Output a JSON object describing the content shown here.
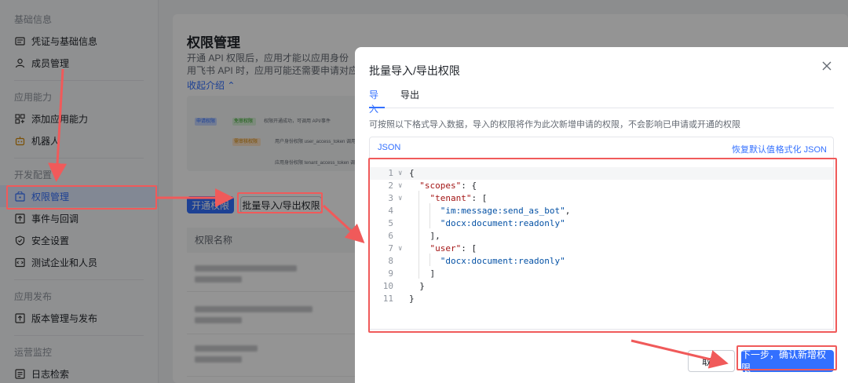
{
  "sidebar": {
    "groups": [
      {
        "title": "基础信息",
        "items": [
          {
            "label": "凭证与基础信息",
            "icon": "id-card-icon"
          },
          {
            "label": "成员管理",
            "icon": "person-icon"
          }
        ]
      },
      {
        "title": "应用能力",
        "items": [
          {
            "label": "添加应用能力",
            "icon": "grid-plus-icon"
          },
          {
            "label": "机器人",
            "icon": "robot-icon"
          }
        ]
      },
      {
        "title": "开发配置",
        "items": [
          {
            "label": "权限管理",
            "icon": "lock-box-icon",
            "active": true
          },
          {
            "label": "事件与回调",
            "icon": "event-icon"
          },
          {
            "label": "安全设置",
            "icon": "shield-icon"
          },
          {
            "label": "测试企业和人员",
            "icon": "test-icon"
          }
        ]
      },
      {
        "title": "应用发布",
        "items": [
          {
            "label": "版本管理与发布",
            "icon": "upload-icon"
          }
        ]
      },
      {
        "title": "运营监控",
        "items": [
          {
            "label": "日志检索",
            "icon": "log-icon"
          }
        ]
      }
    ]
  },
  "main": {
    "title": "权限管理",
    "desc_line1": "开通 API 权限后，应用才能以应用身份（tenan",
    "desc_line2": "用飞书 API 时，应用可能还需要申请对应的数据",
    "collapse_label": "收起介绍 ⌃",
    "flow": {
      "tag1": "申请权限",
      "tag2": "免审权限",
      "tag3": "需审核权限",
      "text1": "权限开通成功，可调用 API/事件",
      "text2": "用户身份权限 user_access_token 调用",
      "text3": "应用身份权限 tenant_access_token 调用"
    },
    "enable_button": "开通权限",
    "batch_button": "批量导入/导出权限",
    "table_header": "权限名称"
  },
  "modal": {
    "title": "批量导入/导出权限",
    "close_icon": "close-icon",
    "tabs": [
      "导入",
      "导出"
    ],
    "hint": "可按照以下格式导入数据，导入的权限将作为此次新增申请的权限，不会影响已申请或开通的权限",
    "editor_tab": "JSON",
    "restore_default": "恢复默认值",
    "format_json": "格式化 JSON",
    "code_lines": [
      {
        "n": "1",
        "text": "{"
      },
      {
        "n": "2",
        "text": "  \"scopes\": {"
      },
      {
        "n": "3",
        "text": "    \"tenant\": ["
      },
      {
        "n": "4",
        "text": "      \"im:message:send_as_bot\","
      },
      {
        "n": "5",
        "text": "      \"docx:document:readonly\""
      },
      {
        "n": "6",
        "text": "    ],"
      },
      {
        "n": "7",
        "text": "    \"user\": ["
      },
      {
        "n": "8",
        "text": "      \"docx:document:readonly\""
      },
      {
        "n": "9",
        "text": "    ]"
      },
      {
        "n": "10",
        "text": "  }"
      },
      {
        "n": "11",
        "text": "}"
      }
    ],
    "cancel_button": "取消",
    "next_button": "下一步，确认新增权限"
  },
  "colors": {
    "accent": "#3370ff",
    "annotation": "#f05a5a"
  }
}
